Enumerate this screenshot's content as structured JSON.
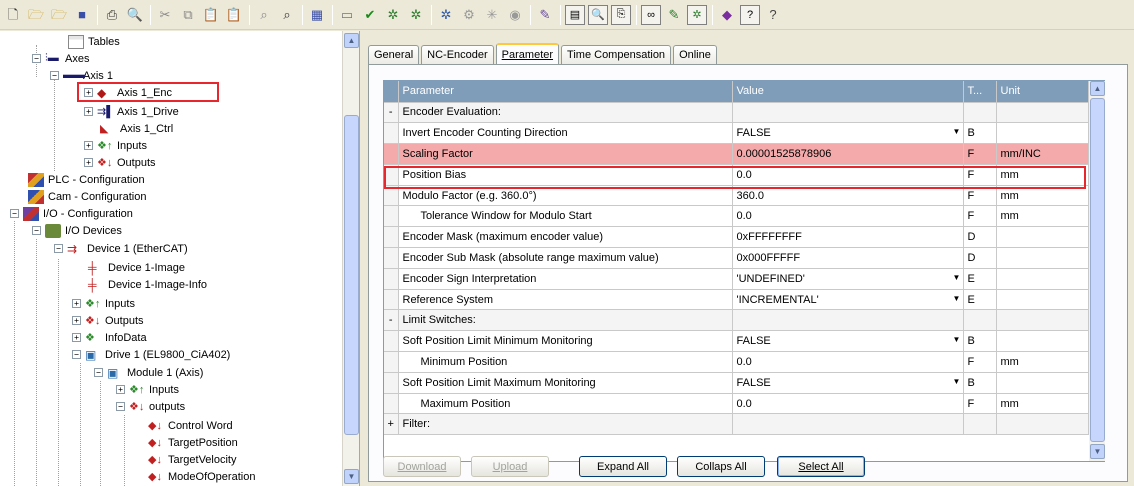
{
  "toolbar": {
    "icons": [
      "new-file-icon",
      "open-icon",
      "open-project-icon",
      "save-icon",
      "print-icon",
      "print-preview-icon",
      "cut-icon",
      "copy-icon",
      "paste-icon",
      "paste-with-links-icon",
      "find-icon",
      "find-next-icon",
      "append-icon",
      "choose-target-icon",
      "activate-config-icon",
      "set-run-mode-icon",
      "check-config-icon",
      "scan-devices-icon",
      "toggle-freerun-icon",
      "show-online-icon",
      "show-sub-items-icon",
      "hex-display-icon",
      "zoom-icon",
      "remote-icon",
      "scope-icon",
      "watch-icon",
      "bus-monitor-icon",
      "book-icon",
      "help-icon",
      "context-help-icon"
    ]
  },
  "tree": {
    "items": [
      {
        "label": "Tables",
        "icon": "table-icon"
      },
      {
        "label": "Axes",
        "icon": "axes-icon",
        "expander": "−"
      },
      {
        "label": "Axis 1",
        "icon": "axis-icon",
        "expander": "−"
      },
      {
        "label": "Axis 1_Enc",
        "icon": "encoder-icon",
        "expander": "+"
      },
      {
        "label": "Axis 1_Drive",
        "icon": "drive-icon",
        "expander": "+"
      },
      {
        "label": "Axis 1_Ctrl",
        "icon": "controller-icon"
      },
      {
        "label": "Inputs",
        "icon": "inputs-icon",
        "expander": "+"
      },
      {
        "label": "Outputs",
        "icon": "outputs-icon",
        "expander": "+"
      },
      {
        "label": "PLC - Configuration",
        "icon": "plc-icon"
      },
      {
        "label": "Cam - Configuration",
        "icon": "cam-icon"
      },
      {
        "label": "I/O - Configuration",
        "icon": "io-config-icon",
        "expander": "−"
      },
      {
        "label": "I/O Devices",
        "icon": "io-devices-icon",
        "expander": "−"
      },
      {
        "label": "Device 1 (EtherCAT)",
        "icon": "ethercat-device-icon",
        "expander": "−"
      },
      {
        "label": "Device 1-Image",
        "icon": "image-icon"
      },
      {
        "label": "Device 1-Image-Info",
        "icon": "image-info-icon"
      },
      {
        "label": "Inputs",
        "icon": "inputs-icon",
        "expander": "+"
      },
      {
        "label": "Outputs",
        "icon": "outputs-icon",
        "expander": "+"
      },
      {
        "label": "InfoData",
        "icon": "infodata-icon",
        "expander": "+"
      },
      {
        "label": "Drive 1 (EL9800_CiA402)",
        "icon": "drive-module-icon",
        "expander": "−"
      },
      {
        "label": "Module 1 (Axis)",
        "icon": "module-icon",
        "expander": "−"
      },
      {
        "label": "Inputs",
        "icon": "inputs-icon",
        "expander": "+"
      },
      {
        "label": "outputs",
        "icon": "outputs-icon",
        "expander": "−"
      },
      {
        "label": "Control Word",
        "icon": "output-var-icon"
      },
      {
        "label": "TargetPosition",
        "icon": "output-var-icon"
      },
      {
        "label": "TargetVelocity",
        "icon": "output-var-icon"
      },
      {
        "label": "ModeOfOperation",
        "icon": "output-var-icon"
      }
    ]
  },
  "tabs": [
    "General",
    "NC-Encoder",
    "Parameter",
    "Time Compensation",
    "Online"
  ],
  "active_tab": "Parameter",
  "grid": {
    "headers": [
      "Parameter",
      "Value",
      "T...",
      "Unit"
    ],
    "rows": [
      {
        "lead": "-",
        "param": "Encoder Evaluation:",
        "value": "",
        "type": "",
        "unit": "",
        "group": true
      },
      {
        "lead": "",
        "param": "Invert Encoder Counting Direction",
        "value": "FALSE",
        "type": "B",
        "unit": "",
        "dropdown": true
      },
      {
        "lead": "",
        "param": "Scaling Factor",
        "value": "0.00001525878906",
        "type": "F",
        "unit": "mm/INC",
        "highlight": true
      },
      {
        "lead": "",
        "param": "Position Bias",
        "value": "0.0",
        "type": "F",
        "unit": "mm"
      },
      {
        "lead": "",
        "param": "Modulo Factor (e.g. 360.0°)",
        "value": "360.0",
        "type": "F",
        "unit": "mm"
      },
      {
        "lead": "",
        "param": "Tolerance Window for Modulo Start",
        "value": "0.0",
        "type": "F",
        "unit": "mm",
        "indent": true
      },
      {
        "lead": "",
        "param": "Encoder Mask (maximum encoder value)",
        "value": "0xFFFFFFFF",
        "type": "D",
        "unit": ""
      },
      {
        "lead": "",
        "param": "Encoder Sub Mask (absolute range maximum value)",
        "value": "0x000FFFFF",
        "type": "D",
        "unit": ""
      },
      {
        "lead": "",
        "param": "Encoder Sign Interpretation",
        "value": "'UNDEFINED'",
        "type": "E",
        "unit": "",
        "dropdown": true
      },
      {
        "lead": "",
        "param": "Reference System",
        "value": "'INCREMENTAL'",
        "type": "E",
        "unit": "",
        "dropdown": true
      },
      {
        "lead": "-",
        "param": "Limit Switches:",
        "value": "",
        "type": "",
        "unit": "",
        "group": true
      },
      {
        "lead": "",
        "param": "Soft Position Limit Minimum Monitoring",
        "value": "FALSE",
        "type": "B",
        "unit": "",
        "dropdown": true
      },
      {
        "lead": "",
        "param": "Minimum Position",
        "value": "0.0",
        "type": "F",
        "unit": "mm",
        "indent": true
      },
      {
        "lead": "",
        "param": "Soft Position Limit Maximum Monitoring",
        "value": "FALSE",
        "type": "B",
        "unit": "",
        "dropdown": true
      },
      {
        "lead": "",
        "param": "Maximum Position",
        "value": "0.0",
        "type": "F",
        "unit": "mm",
        "indent": true
      },
      {
        "lead": "+",
        "param": "Filter:",
        "value": "",
        "type": "",
        "unit": "",
        "group": true
      }
    ]
  },
  "buttons": {
    "download": "Download",
    "upload": "Upload",
    "expand_all": "Expand All",
    "collaps_all": "Collaps All",
    "select_all": "Select All"
  },
  "colors": {
    "highlight_border": "#e8262e",
    "highlight_fill": "#f4aaaa",
    "grid_header": "#7f9db9"
  }
}
